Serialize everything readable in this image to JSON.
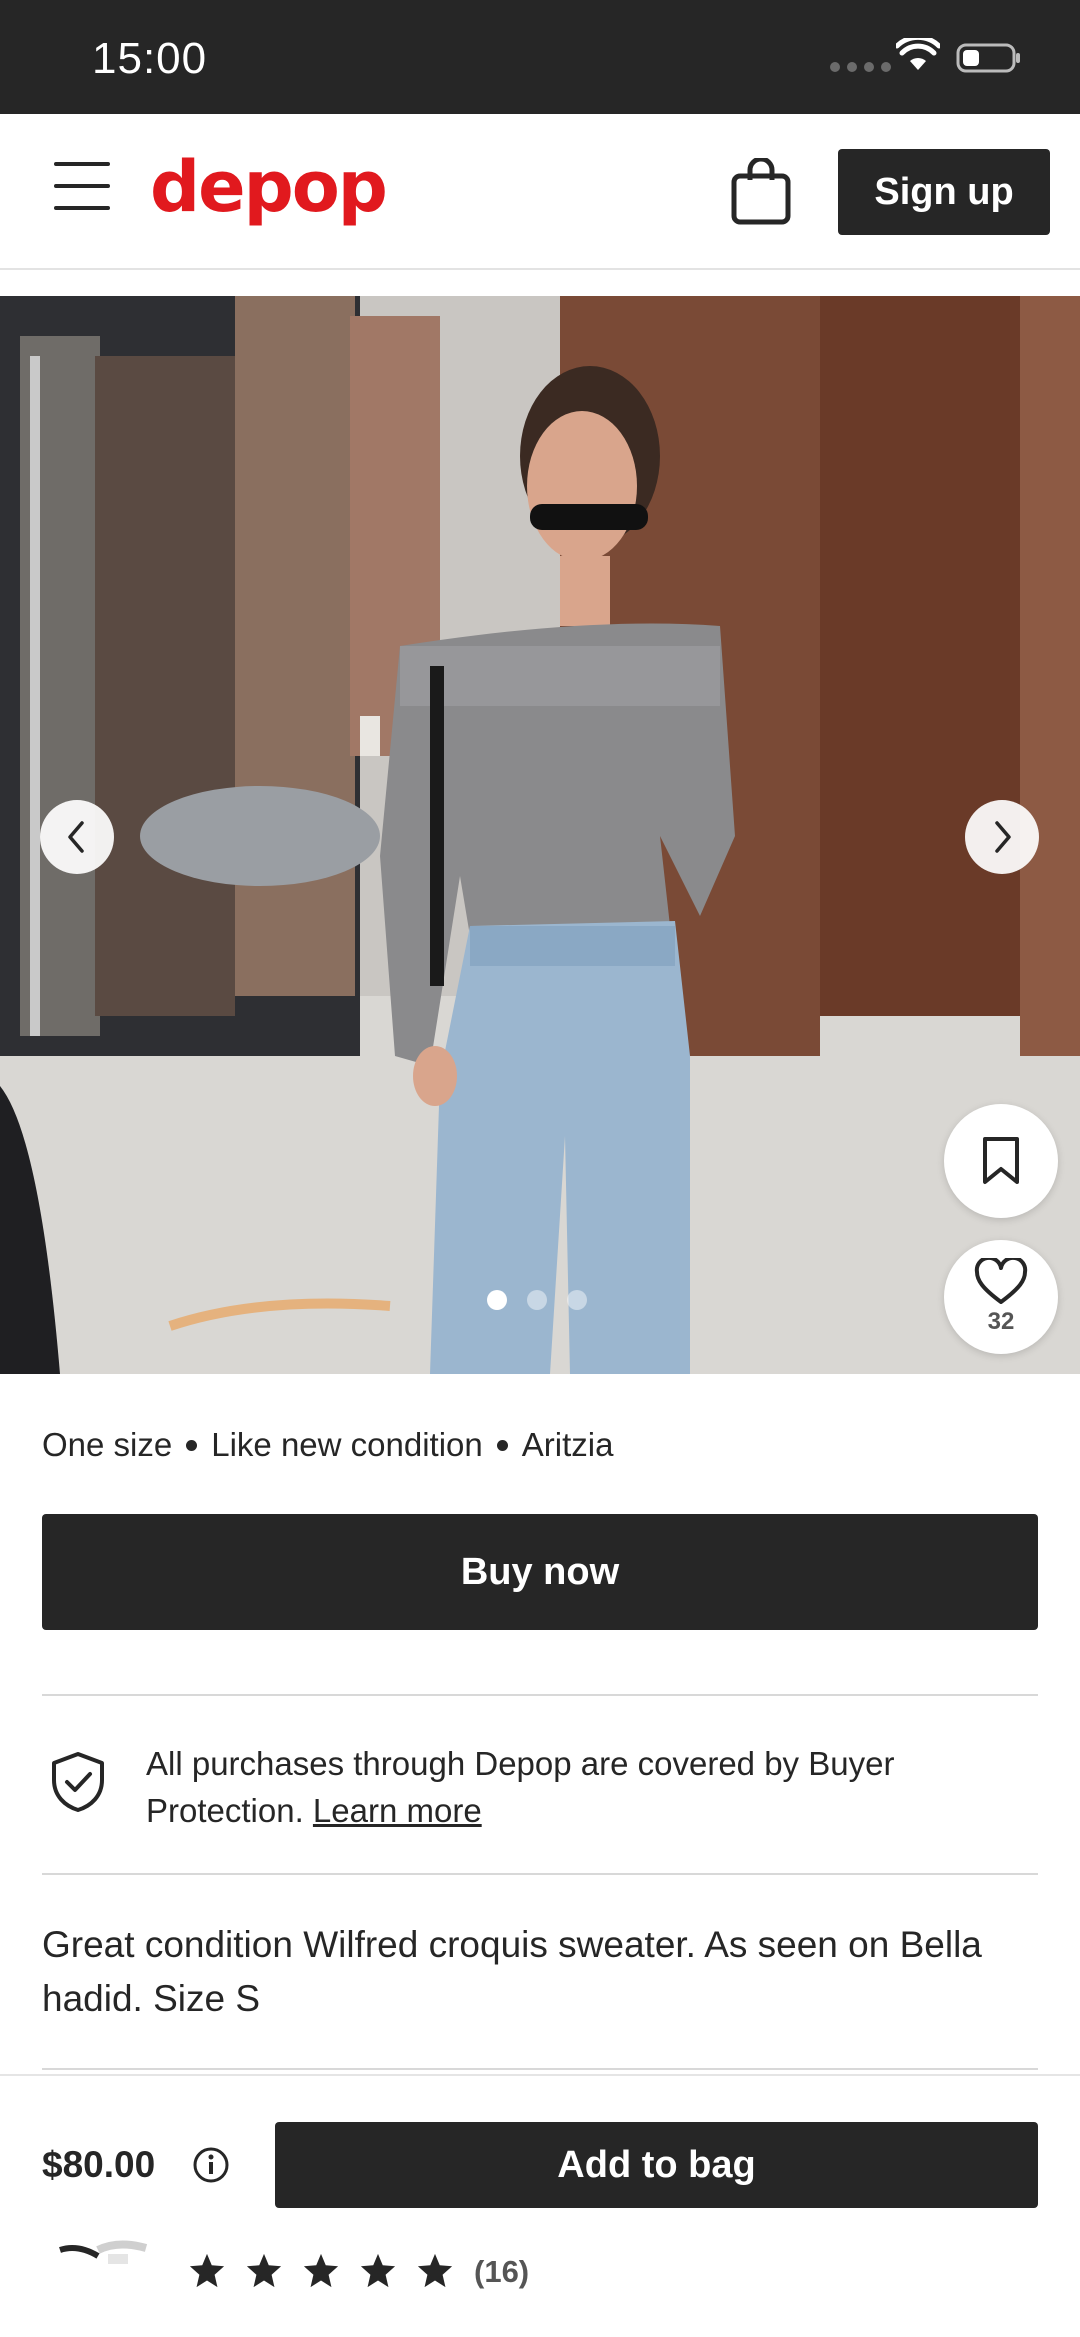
{
  "status_bar": {
    "time": "15:00"
  },
  "header": {
    "logo": "depop",
    "signup_label": "Sign up"
  },
  "carousel": {
    "image_count": 3,
    "active_index": 0
  },
  "like_count": "32",
  "attributes": {
    "size": "One size",
    "condition": "Like new condition",
    "brand": "Aritzia"
  },
  "buy_now_label": "Buy now",
  "protection": {
    "text": "All purchases through Depop are covered by Buyer Protection.",
    "link": "Learn more"
  },
  "description": "Great condition Wilfred croquis sweater. As seen on Bella hadid. Size S",
  "bottom_bar": {
    "price": "$80.00",
    "add_to_bag_label": "Add to bag",
    "rating_stars": 5,
    "review_count": "(16)"
  },
  "colors": {
    "brand_red": "#e1191e",
    "dark": "#262626"
  }
}
